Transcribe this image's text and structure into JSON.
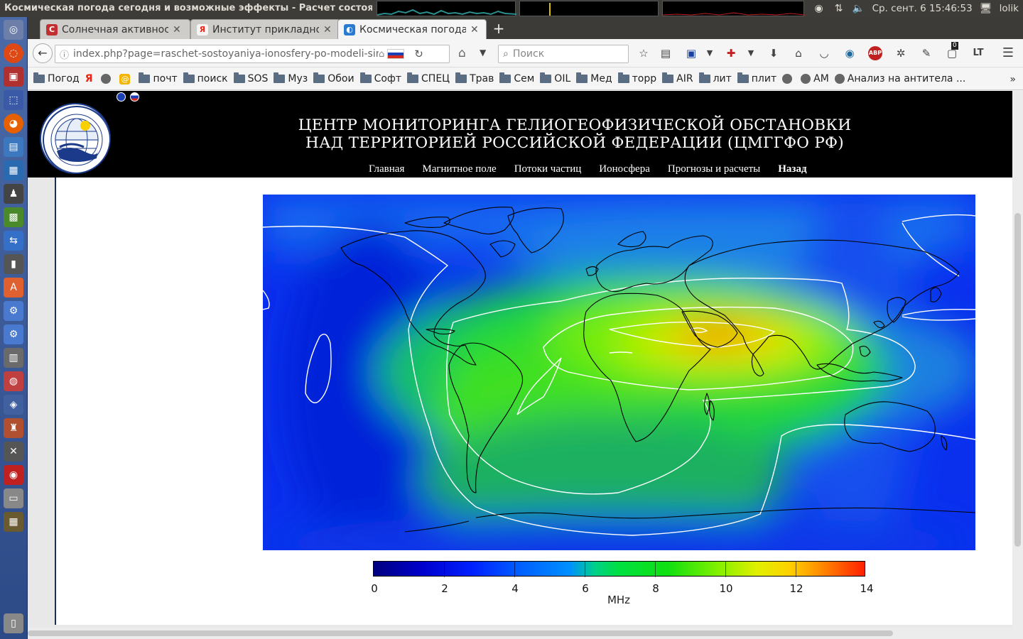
{
  "system": {
    "window_title": "Космическая погода сегодня и возможные эффекты - Расчет состоян",
    "clock": "Ср. сент.  6 15:46:53",
    "user": "lolik"
  },
  "tabs": [
    {
      "label": "Солнечная активност",
      "favicon": "C"
    },
    {
      "label": "Институт прикладной",
      "favicon": "Я"
    },
    {
      "label": "Космическая погода с",
      "favicon": "◐"
    }
  ],
  "navbar": {
    "url": "index.php?page=raschet-sostoyaniya-ionosfery-po-modeli-simp",
    "search_placeholder": "Поиск",
    "lt_badge": "LT",
    "counter_badge": "0"
  },
  "bookmarks": [
    {
      "type": "folder",
      "label": "Погод"
    },
    {
      "type": "ya",
      "label": ""
    },
    {
      "type": "globe",
      "label": ""
    },
    {
      "type": "at",
      "label": ""
    },
    {
      "type": "folder",
      "label": "почт"
    },
    {
      "type": "folder",
      "label": "поиск"
    },
    {
      "type": "folder",
      "label": "SOS"
    },
    {
      "type": "folder",
      "label": "Муз"
    },
    {
      "type": "folder",
      "label": "Обои"
    },
    {
      "type": "folder",
      "label": "Софт"
    },
    {
      "type": "folder",
      "label": "СПЕЦ"
    },
    {
      "type": "folder",
      "label": "Трав"
    },
    {
      "type": "folder",
      "label": "Сем"
    },
    {
      "type": "folder",
      "label": "OIL"
    },
    {
      "type": "folder",
      "label": "Мед"
    },
    {
      "type": "folder",
      "label": "торр"
    },
    {
      "type": "folder",
      "label": "AIR"
    },
    {
      "type": "folder",
      "label": "лит"
    },
    {
      "type": "folder",
      "label": "плит"
    },
    {
      "type": "globe",
      "label": ""
    },
    {
      "type": "globe",
      "label": "AM"
    },
    {
      "type": "globe",
      "label": "Анализ на антитела ..."
    }
  ],
  "site": {
    "title_line1": "ЦЕНТР МОНИТОРИНГА ГЕЛИОГЕОФИЗИЧЕСКОЙ ОБСТАНОВКИ",
    "title_line2": "НАД ТЕРРИТОРИЕЙ РОССИЙСКОЙ ФЕДЕРАЦИИ (ЦМГГФО РФ)",
    "nav": [
      "Главная",
      "Магнитное поле",
      "Потоки частиц",
      "Ионосфера",
      "Прогнозы и расчеты",
      "Назад"
    ],
    "nav_active": "Назад"
  },
  "colorbar": {
    "ticks": [
      "0",
      "2",
      "4",
      "6",
      "8",
      "10",
      "12",
      "14"
    ],
    "unit": "MHz",
    "min": 0,
    "max": 14
  },
  "colors": {
    "launcher": "#2c4a86",
    "header_bg": "#000000",
    "ocean_low": "#0030f0",
    "peak": "#ff3000"
  }
}
